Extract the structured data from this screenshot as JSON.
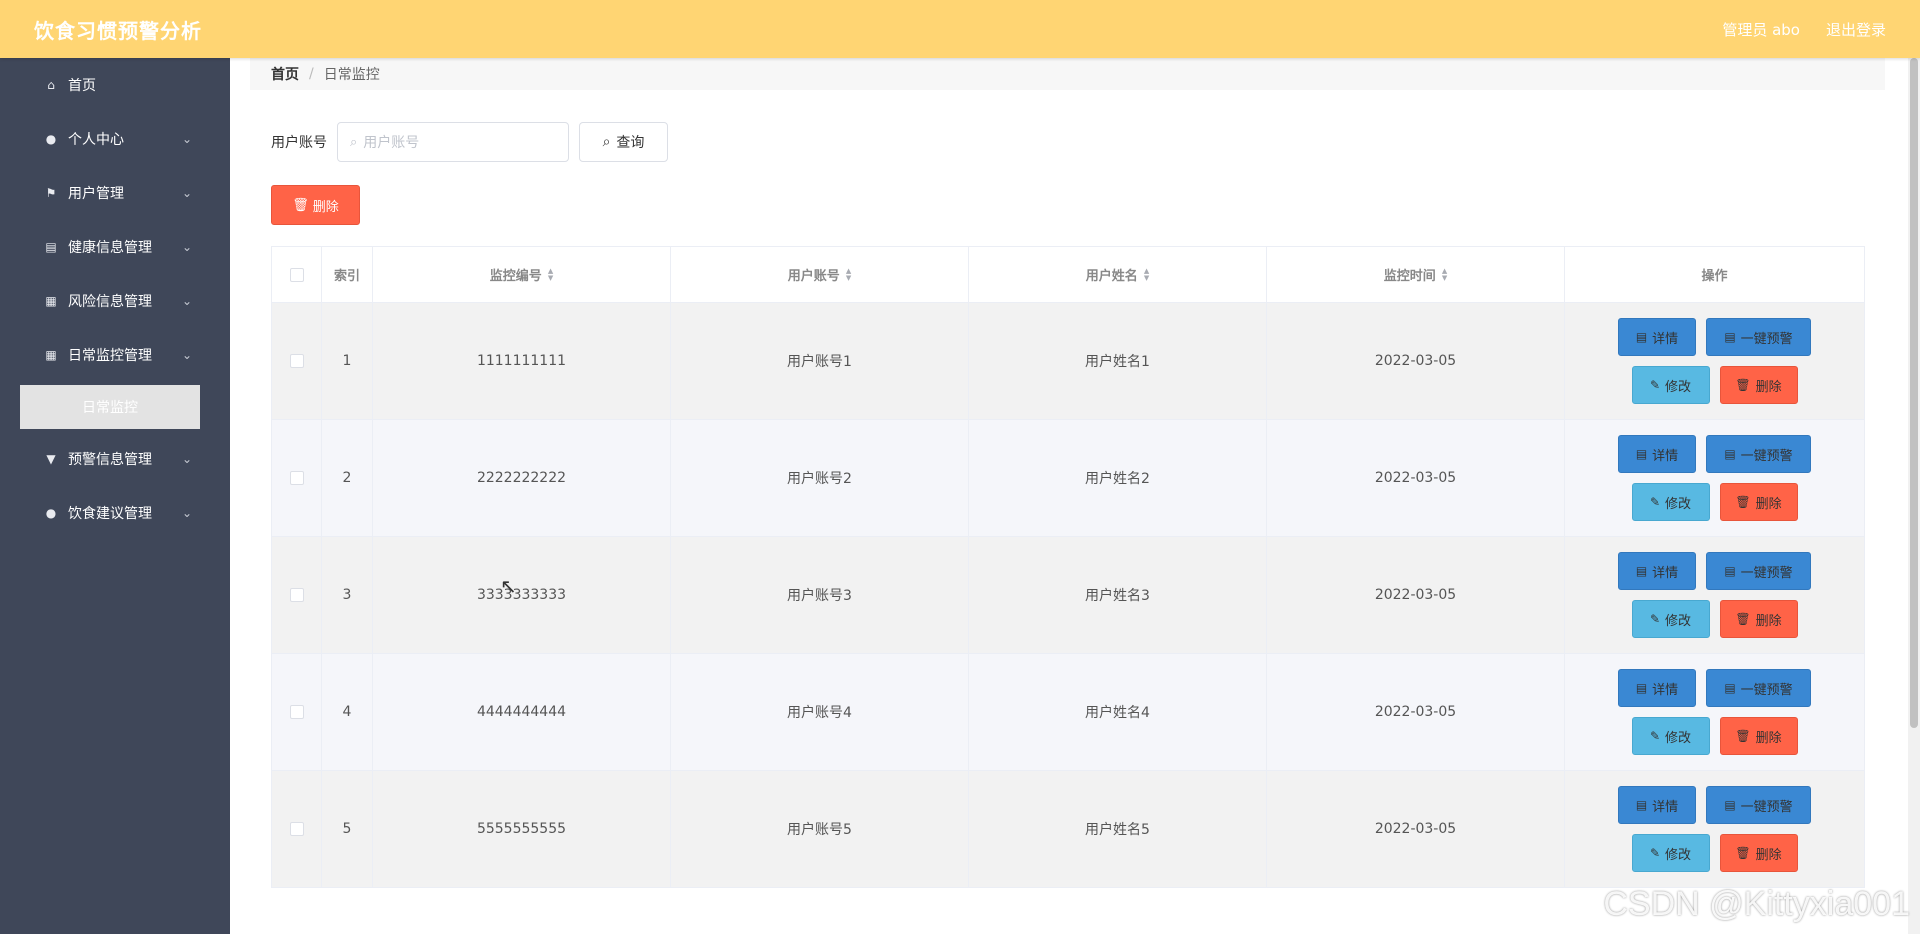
{
  "header": {
    "title": "饮食习惯预警分析",
    "user": "管理员 abo",
    "logout": "退出登录"
  },
  "sidebar": {
    "items": [
      {
        "label": "首页",
        "icon": "home-icon",
        "glyph": "⌂",
        "has_children": false
      },
      {
        "label": "个人中心",
        "icon": "user-icon",
        "glyph": "●",
        "has_children": true
      },
      {
        "label": "用户管理",
        "icon": "flag-icon",
        "glyph": "⚑",
        "has_children": true
      },
      {
        "label": "健康信息管理",
        "icon": "clipboard-icon",
        "glyph": "▤",
        "has_children": true
      },
      {
        "label": "风险信息管理",
        "icon": "chart-icon",
        "glyph": "▦",
        "has_children": true
      },
      {
        "label": "日常监控管理",
        "icon": "grid-icon",
        "glyph": "▦",
        "has_children": true
      },
      {
        "label": "预警信息管理",
        "icon": "alert-icon",
        "glyph": "▼",
        "has_children": true
      },
      {
        "label": "饮食建议管理",
        "icon": "person-icon",
        "glyph": "●",
        "has_children": true
      }
    ],
    "active_sub": "日常监控"
  },
  "breadcrumb": {
    "home": "首页",
    "current": "日常监控"
  },
  "search": {
    "label": "用户账号",
    "placeholder": "用户账号",
    "button": "查询"
  },
  "actions": {
    "delete": "删除"
  },
  "table": {
    "headers": {
      "index": "索引",
      "monitor_no": "监控编号",
      "account": "用户账号",
      "name": "用户姓名",
      "time": "监控时间",
      "ops": "操作"
    },
    "buttons": {
      "detail": "详情",
      "warn": "一键预警",
      "edit": "修改",
      "delete": "删除"
    },
    "rows": [
      {
        "index": "1",
        "monitor_no": "1111111111",
        "account": "用户账号1",
        "name": "用户姓名1",
        "time": "2022-03-05"
      },
      {
        "index": "2",
        "monitor_no": "2222222222",
        "account": "用户账号2",
        "name": "用户姓名2",
        "time": "2022-03-05"
      },
      {
        "index": "3",
        "monitor_no": "3333333333",
        "account": "用户账号3",
        "name": "用户姓名3",
        "time": "2022-03-05"
      },
      {
        "index": "4",
        "monitor_no": "4444444444",
        "account": "用户账号4",
        "name": "用户姓名4",
        "time": "2022-03-05"
      },
      {
        "index": "5",
        "monitor_no": "5555555555",
        "account": "用户账号5",
        "name": "用户姓名5",
        "time": "2022-03-05"
      }
    ]
  },
  "watermark": "CSDN @Kittyxia001",
  "colors": {
    "topbar": "#ffd573",
    "sidebar": "#3f4759",
    "primary": "#3a88d3",
    "info": "#58b9e2",
    "danger": "#ff6347"
  }
}
